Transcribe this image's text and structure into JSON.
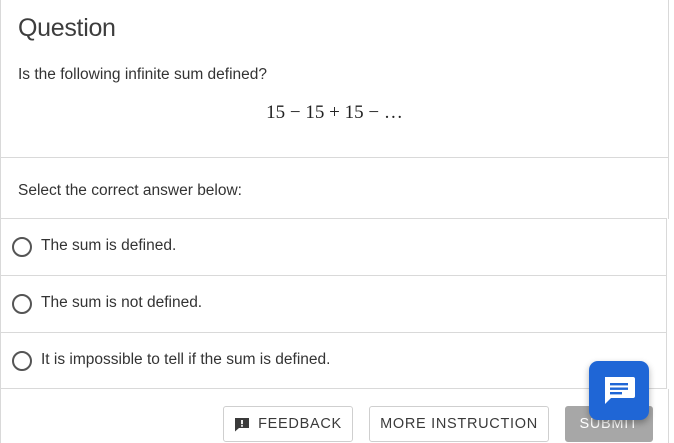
{
  "question": {
    "title": "Question",
    "prompt": "Is the following infinite sum defined?",
    "math": "15 − 15 + 15 − …"
  },
  "instruction": "Select the correct answer below:",
  "options": [
    {
      "label": "The sum is defined."
    },
    {
      "label": "The sum is not defined."
    },
    {
      "label": "It is impossible to tell if the sum is defined."
    }
  ],
  "footer": {
    "feedback_label": "FEEDBACK",
    "more_instruction_label": "MORE INSTRUCTION",
    "submit_label": "SUBMIT"
  },
  "icons": {
    "feedback": "feedback-icon",
    "chat": "chat-icon"
  },
  "colors": {
    "chat_button": "#1f66d6",
    "submit_disabled": "#a7a7a7",
    "border": "#d9d9d9"
  }
}
